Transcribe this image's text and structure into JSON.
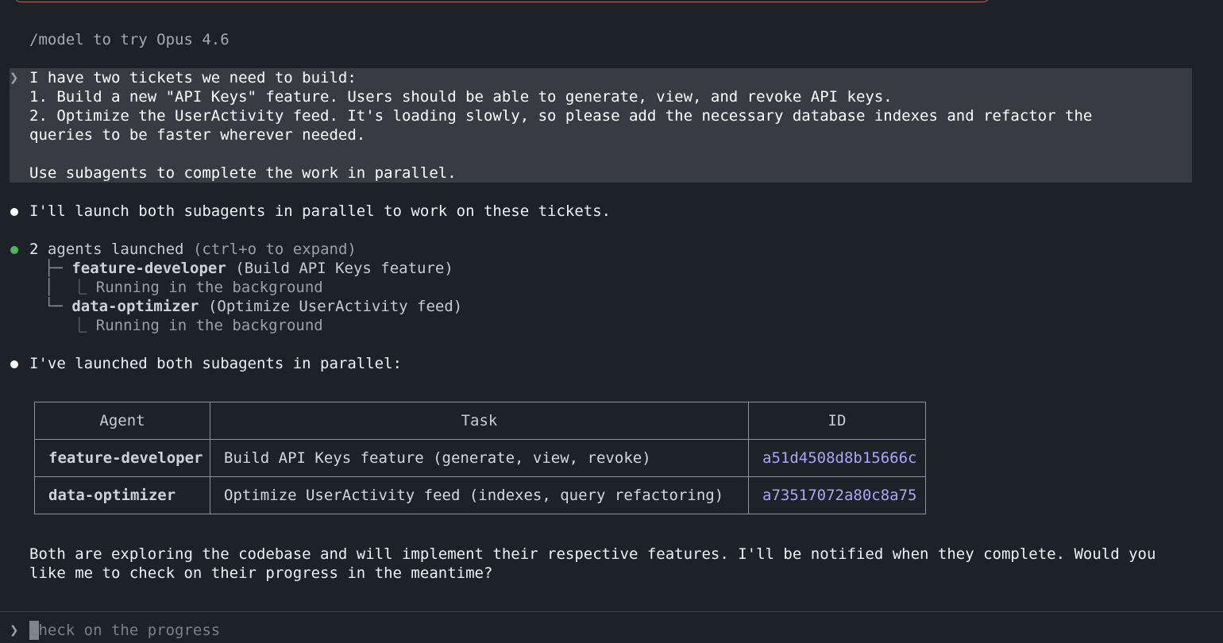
{
  "hint": "/model to try Opus 4.6",
  "user_message": {
    "prompt_symbol": "❯",
    "lines": [
      "I have two tickets we need to build:",
      "1. Build a new \"API Keys\" feature. Users should be able to generate, view, and revoke API keys.",
      "2. Optimize the UserActivity feed. It's loading slowly, so please add the necessary database indexes and refactor the",
      "queries to be faster wherever needed.",
      "",
      "Use subagents to complete the work in parallel."
    ]
  },
  "assistant_intro": "I'll launch both subagents in parallel to work on these tickets.",
  "agents_launched": {
    "count_label": "2",
    "label": "agents launched",
    "hint": "(ctrl+o to expand)",
    "items": [
      {
        "name": "feature-developer",
        "desc": "(Build API Keys feature)",
        "status": "Running in the background"
      },
      {
        "name": "data-optimizer",
        "desc": "(Optimize UserActivity feed)",
        "status": "Running in the background"
      }
    ]
  },
  "assistant_summary": "I've launched both subagents in parallel:",
  "table": {
    "headers": [
      "Agent",
      "Task",
      "ID"
    ],
    "rows": [
      {
        "agent": "feature-developer",
        "task": "Build API Keys feature (generate, view, revoke)",
        "id": "a51d4508d8b15666c"
      },
      {
        "agent": "data-optimizer",
        "task": "Optimize UserActivity feed (indexes, query refactoring)",
        "id": "a73517072a80c8a75"
      }
    ]
  },
  "closing": [
    "Both are exploring the codebase and will implement their respective features. I'll be notified when they complete. Would you",
    "like me to check on their progress in the meantime?"
  ],
  "input": {
    "prompt_symbol": "❯",
    "placeholder": "check on the progress",
    "value": ""
  },
  "colors": {
    "background": "#1d2229",
    "user_block": "#383c42",
    "green_dot": "#4fb55c",
    "id_link": "#a6a8f5"
  }
}
